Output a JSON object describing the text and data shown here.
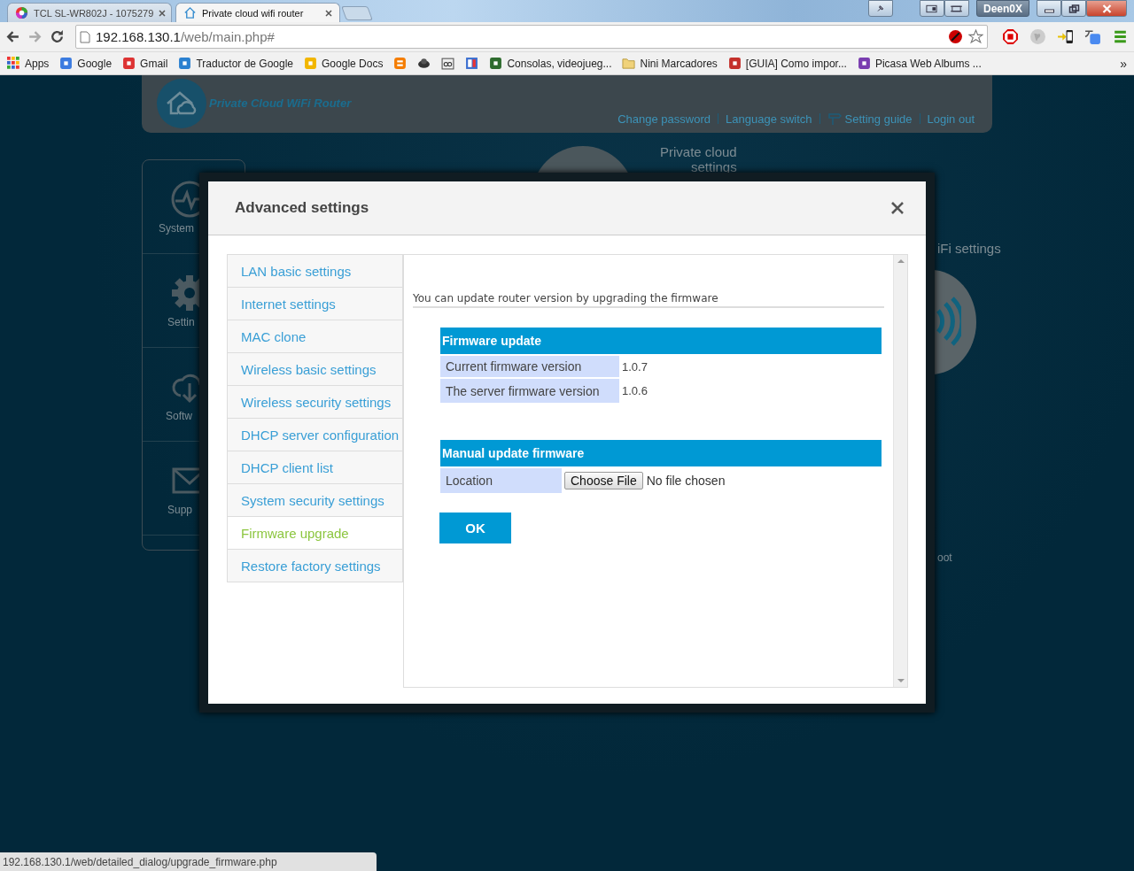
{
  "browser": {
    "tabs": [
      {
        "title": "TCL SL-WR802J - 1075279",
        "selected": false
      },
      {
        "title": "Private cloud wifi router",
        "selected": true
      }
    ],
    "profile": "Deen0X",
    "url": {
      "host": "192.168.130.1",
      "path": "/web/main.php#"
    },
    "bookmarks": [
      {
        "label": "Apps"
      },
      {
        "label": "Google"
      },
      {
        "label": "Gmail"
      },
      {
        "label": "Traductor de Google"
      },
      {
        "label": "Google Docs"
      },
      {
        "label": "Consolas, videojueg..."
      },
      {
        "label": "Nini Marcadores"
      },
      {
        "label": "[GUIA] Como impor..."
      },
      {
        "label": "Picasa Web Albums ..."
      }
    ],
    "bookmarks_more": "»"
  },
  "page": {
    "logo": "Private Cloud WiFi Router",
    "links": [
      "Change password",
      "Language switch",
      "Setting guide",
      "Login out"
    ],
    "sidebar": [
      "System",
      "Settin",
      "Softw",
      "Supp"
    ],
    "tiles": [
      "Private cloud",
      "settings",
      "iFi settings",
      "oot"
    ]
  },
  "dialog": {
    "title": "Advanced settings",
    "nav": [
      {
        "label": "LAN basic settings",
        "selected": false
      },
      {
        "label": "Internet settings",
        "selected": false
      },
      {
        "label": "MAC clone",
        "selected": false
      },
      {
        "label": "Wireless basic settings",
        "selected": false
      },
      {
        "label": "Wireless security settings",
        "selected": false
      },
      {
        "label": "DHCP server configuration",
        "selected": false
      },
      {
        "label": "DHCP client list",
        "selected": false
      },
      {
        "label": "System security settings",
        "selected": false
      },
      {
        "label": "Firmware upgrade",
        "selected": true
      },
      {
        "label": "Restore factory settings",
        "selected": false
      }
    ],
    "intro": "You can update router version by upgrading the firmware",
    "sections": [
      {
        "title": "Firmware update",
        "rows": [
          {
            "kind": "text",
            "label": "Current firmware version",
            "value": "1.0.7"
          },
          {
            "kind": "text",
            "label": "The server firmware version",
            "value": "1.0.6"
          }
        ]
      },
      {
        "title": "Manual update firmware",
        "rows": [
          {
            "kind": "file",
            "label": "Location",
            "button": "Choose File",
            "value": "No file chosen"
          }
        ]
      }
    ],
    "ok": "OK"
  },
  "status_bar": "192.168.130.1/web/detailed_dialog/upgrade_firmware.php"
}
